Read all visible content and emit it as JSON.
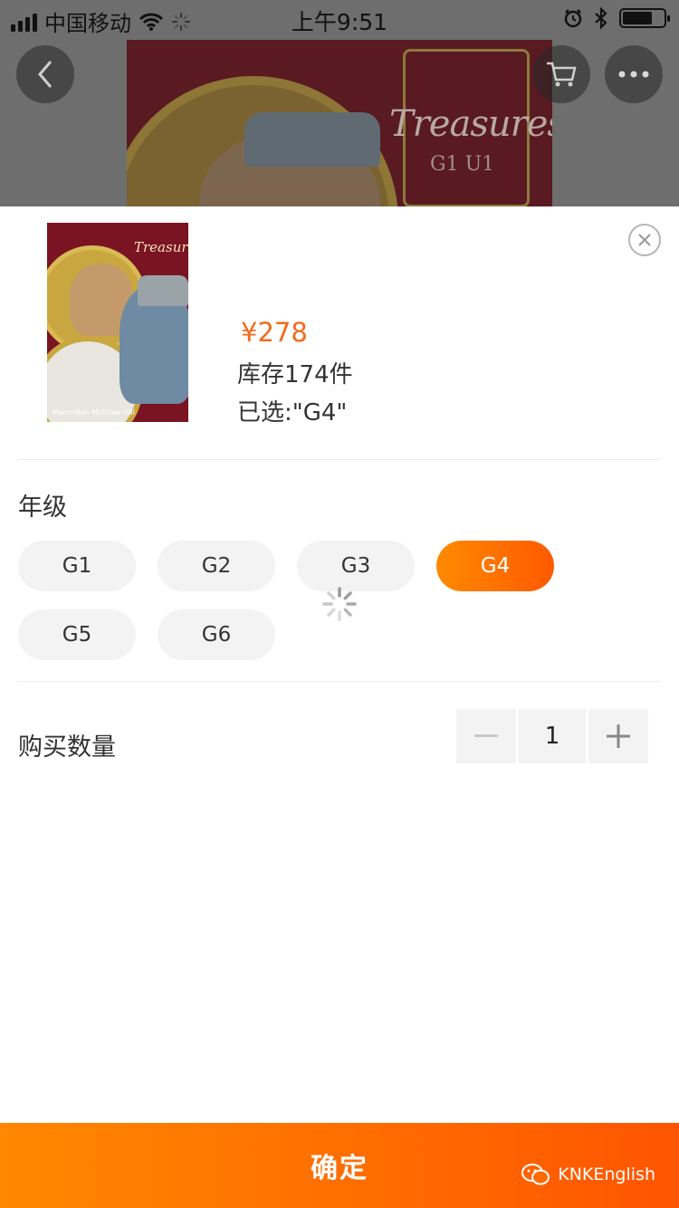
{
  "status_bar": {
    "carrier": "中国移动",
    "time": "上午9:51",
    "battery_level": 0.72
  },
  "hero": {
    "cover_title": "Treasures",
    "cover_sub": "G1 U1"
  },
  "product": {
    "price": "¥278",
    "stock": "库存174件",
    "selected": "已选:\"G4\"",
    "thumb_title": "Treasures",
    "thumb_publisher": "Macmillan McGraw-Hill"
  },
  "grade": {
    "title": "年级",
    "options": [
      "G1",
      "G2",
      "G3",
      "G4",
      "G5",
      "G6"
    ],
    "selected": "G4"
  },
  "quantity": {
    "label": "购买数量",
    "minus": "−",
    "value": "1",
    "plus": "+"
  },
  "confirm": {
    "label": "确定"
  },
  "watermark": {
    "text": "KNKEnglish"
  },
  "colors": {
    "accent": "#ff6a00",
    "price": "#f26a1b"
  }
}
